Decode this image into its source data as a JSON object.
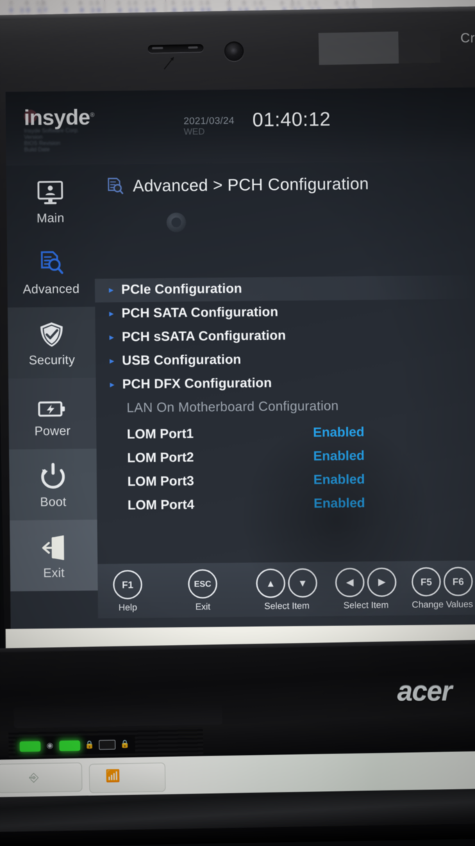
{
  "photo": {
    "device_brand": "acer",
    "bezel_partial_text": "Cr"
  },
  "bios": {
    "vendor": "insyde",
    "vendor_trademark": "®",
    "vendor_sub_lines": [
      "Insyde Software Corp.",
      "Version",
      "BIOS Revision",
      "Build Date"
    ],
    "date": "2021/03/24",
    "weekday": "WED",
    "time": "01:40:12",
    "breadcrumb": "Advanced > PCH Configuration",
    "breadcrumb_icon": "document-search-icon"
  },
  "sidebar": {
    "items": [
      {
        "label": "Main",
        "icon": "monitor-user-icon",
        "active": false
      },
      {
        "label": "Advanced",
        "icon": "document-search-icon",
        "active": true
      },
      {
        "label": "Security",
        "icon": "shield-check-icon",
        "active": false
      },
      {
        "label": "Power",
        "icon": "battery-bolt-icon",
        "active": false
      },
      {
        "label": "Boot",
        "icon": "power-refresh-icon",
        "active": false
      },
      {
        "label": "Exit",
        "icon": "exit-door-icon",
        "active": false
      }
    ]
  },
  "main": {
    "submenus": [
      {
        "label": "PCIe Configuration",
        "selected": true
      },
      {
        "label": "PCH SATA Configuration",
        "selected": false
      },
      {
        "label": "PCH sSATA Configuration",
        "selected": false
      },
      {
        "label": "USB Configuration",
        "selected": false
      },
      {
        "label": "PCH DFX Configuration",
        "selected": false
      }
    ],
    "section_title": "LAN On Motherboard Configuration",
    "lan_ports": [
      {
        "name": "LOM Port1",
        "value": "Enabled"
      },
      {
        "name": "LOM Port2",
        "value": "Enabled"
      },
      {
        "name": "LOM Port3",
        "value": "Enabled"
      },
      {
        "name": "LOM Port4",
        "value": "Enabled"
      }
    ]
  },
  "function_bar": {
    "groups": [
      {
        "keys": [
          "F1"
        ],
        "label": "Help"
      },
      {
        "keys": [
          "ESC"
        ],
        "label": "Exit"
      },
      {
        "keys": [
          "▲",
          "▼"
        ],
        "label": "Select Item"
      },
      {
        "keys": [
          "◀",
          "▶"
        ],
        "label": "Select Item"
      },
      {
        "keys": [
          "F5",
          "F6"
        ],
        "label": "Change Values"
      }
    ]
  },
  "colors": {
    "value_blue": "#27a6f0",
    "arrow_blue": "#3d7de0",
    "text_white": "#f2f4f6",
    "section_gray": "#9ba3ad",
    "screen_bg": "#262b33",
    "led_green": "#35e635"
  }
}
